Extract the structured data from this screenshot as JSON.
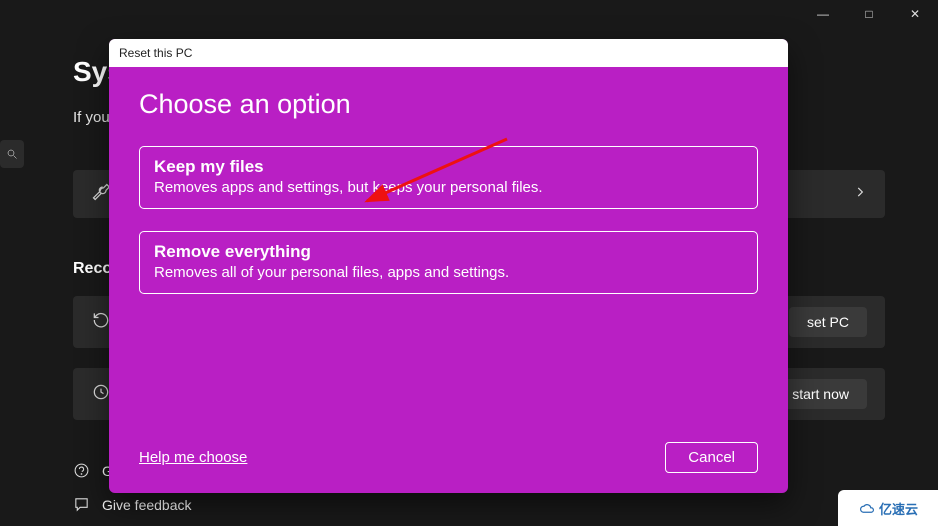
{
  "window": {
    "title_partial": "Sys",
    "subtitle_partial": "If you",
    "controls": {
      "min": "—",
      "max": "□",
      "close": "✕"
    }
  },
  "background": {
    "section_label": "Recov",
    "row2_button": "set PC",
    "row3_button": "start now"
  },
  "footer": {
    "link1": "G",
    "link2": "Give feedback"
  },
  "dialog": {
    "header": "Reset this PC",
    "title": "Choose an option",
    "options": [
      {
        "title": "Keep my files",
        "desc": "Removes apps and settings, but keeps your personal files."
      },
      {
        "title": "Remove everything",
        "desc": "Removes all of your personal files, apps and settings."
      }
    ],
    "help": "Help me choose",
    "cancel": "Cancel"
  },
  "watermark": "亿速云"
}
